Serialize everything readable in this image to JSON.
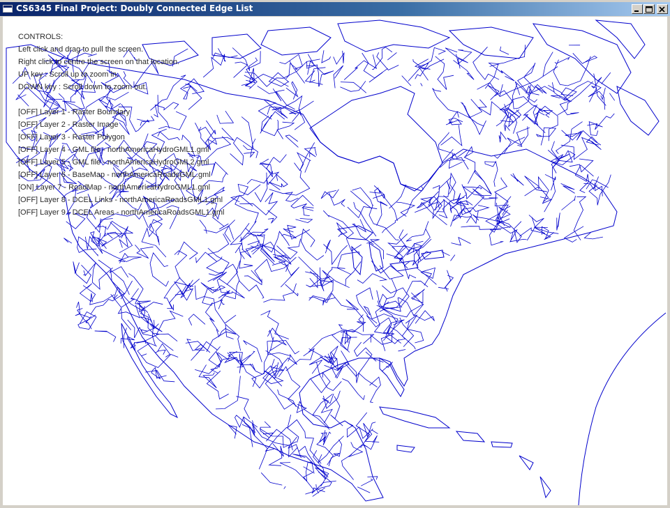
{
  "window": {
    "title": "CS6345 Final Project: Doubly Connected Edge List"
  },
  "controls": {
    "heading": "CONTROLS:",
    "instructions": [
      "Left click and drag to pull the screen.",
      "Right click to centre the screen on that location.",
      "UP key : Scroll up to zoom in.",
      "DOWN key : Scroll down to zoom out."
    ],
    "layers": [
      "[OFF] Layer 1 - Raster Boundary",
      "[OFF] Layer 2 - Raster Image",
      "[OFF] Layer 3 - Raster Polygon",
      "[OFF] Layer 4 - GML file - northAmericaHydroGML1.gml",
      "[OFF] Layer 5 - GML file - northAmericaHydroGML2.gml",
      "[OFF] Layer 6 - BaseMap - northAmericaRoadsGML.gml",
      "[ON] Layer 7 - RoadMap - northAmericaHydroGML1.gml",
      "[OFF] Layer 8 - DCEL Links - northAmericaRoadsGML1.gml",
      "[OFF] Layer 9 - DCEL Areas - northAmericaRoadsGML1.gml"
    ]
  },
  "colors": {
    "map_lines": "#0000cc",
    "titlebar": "#0a246a",
    "canvas": "#ffffff"
  }
}
